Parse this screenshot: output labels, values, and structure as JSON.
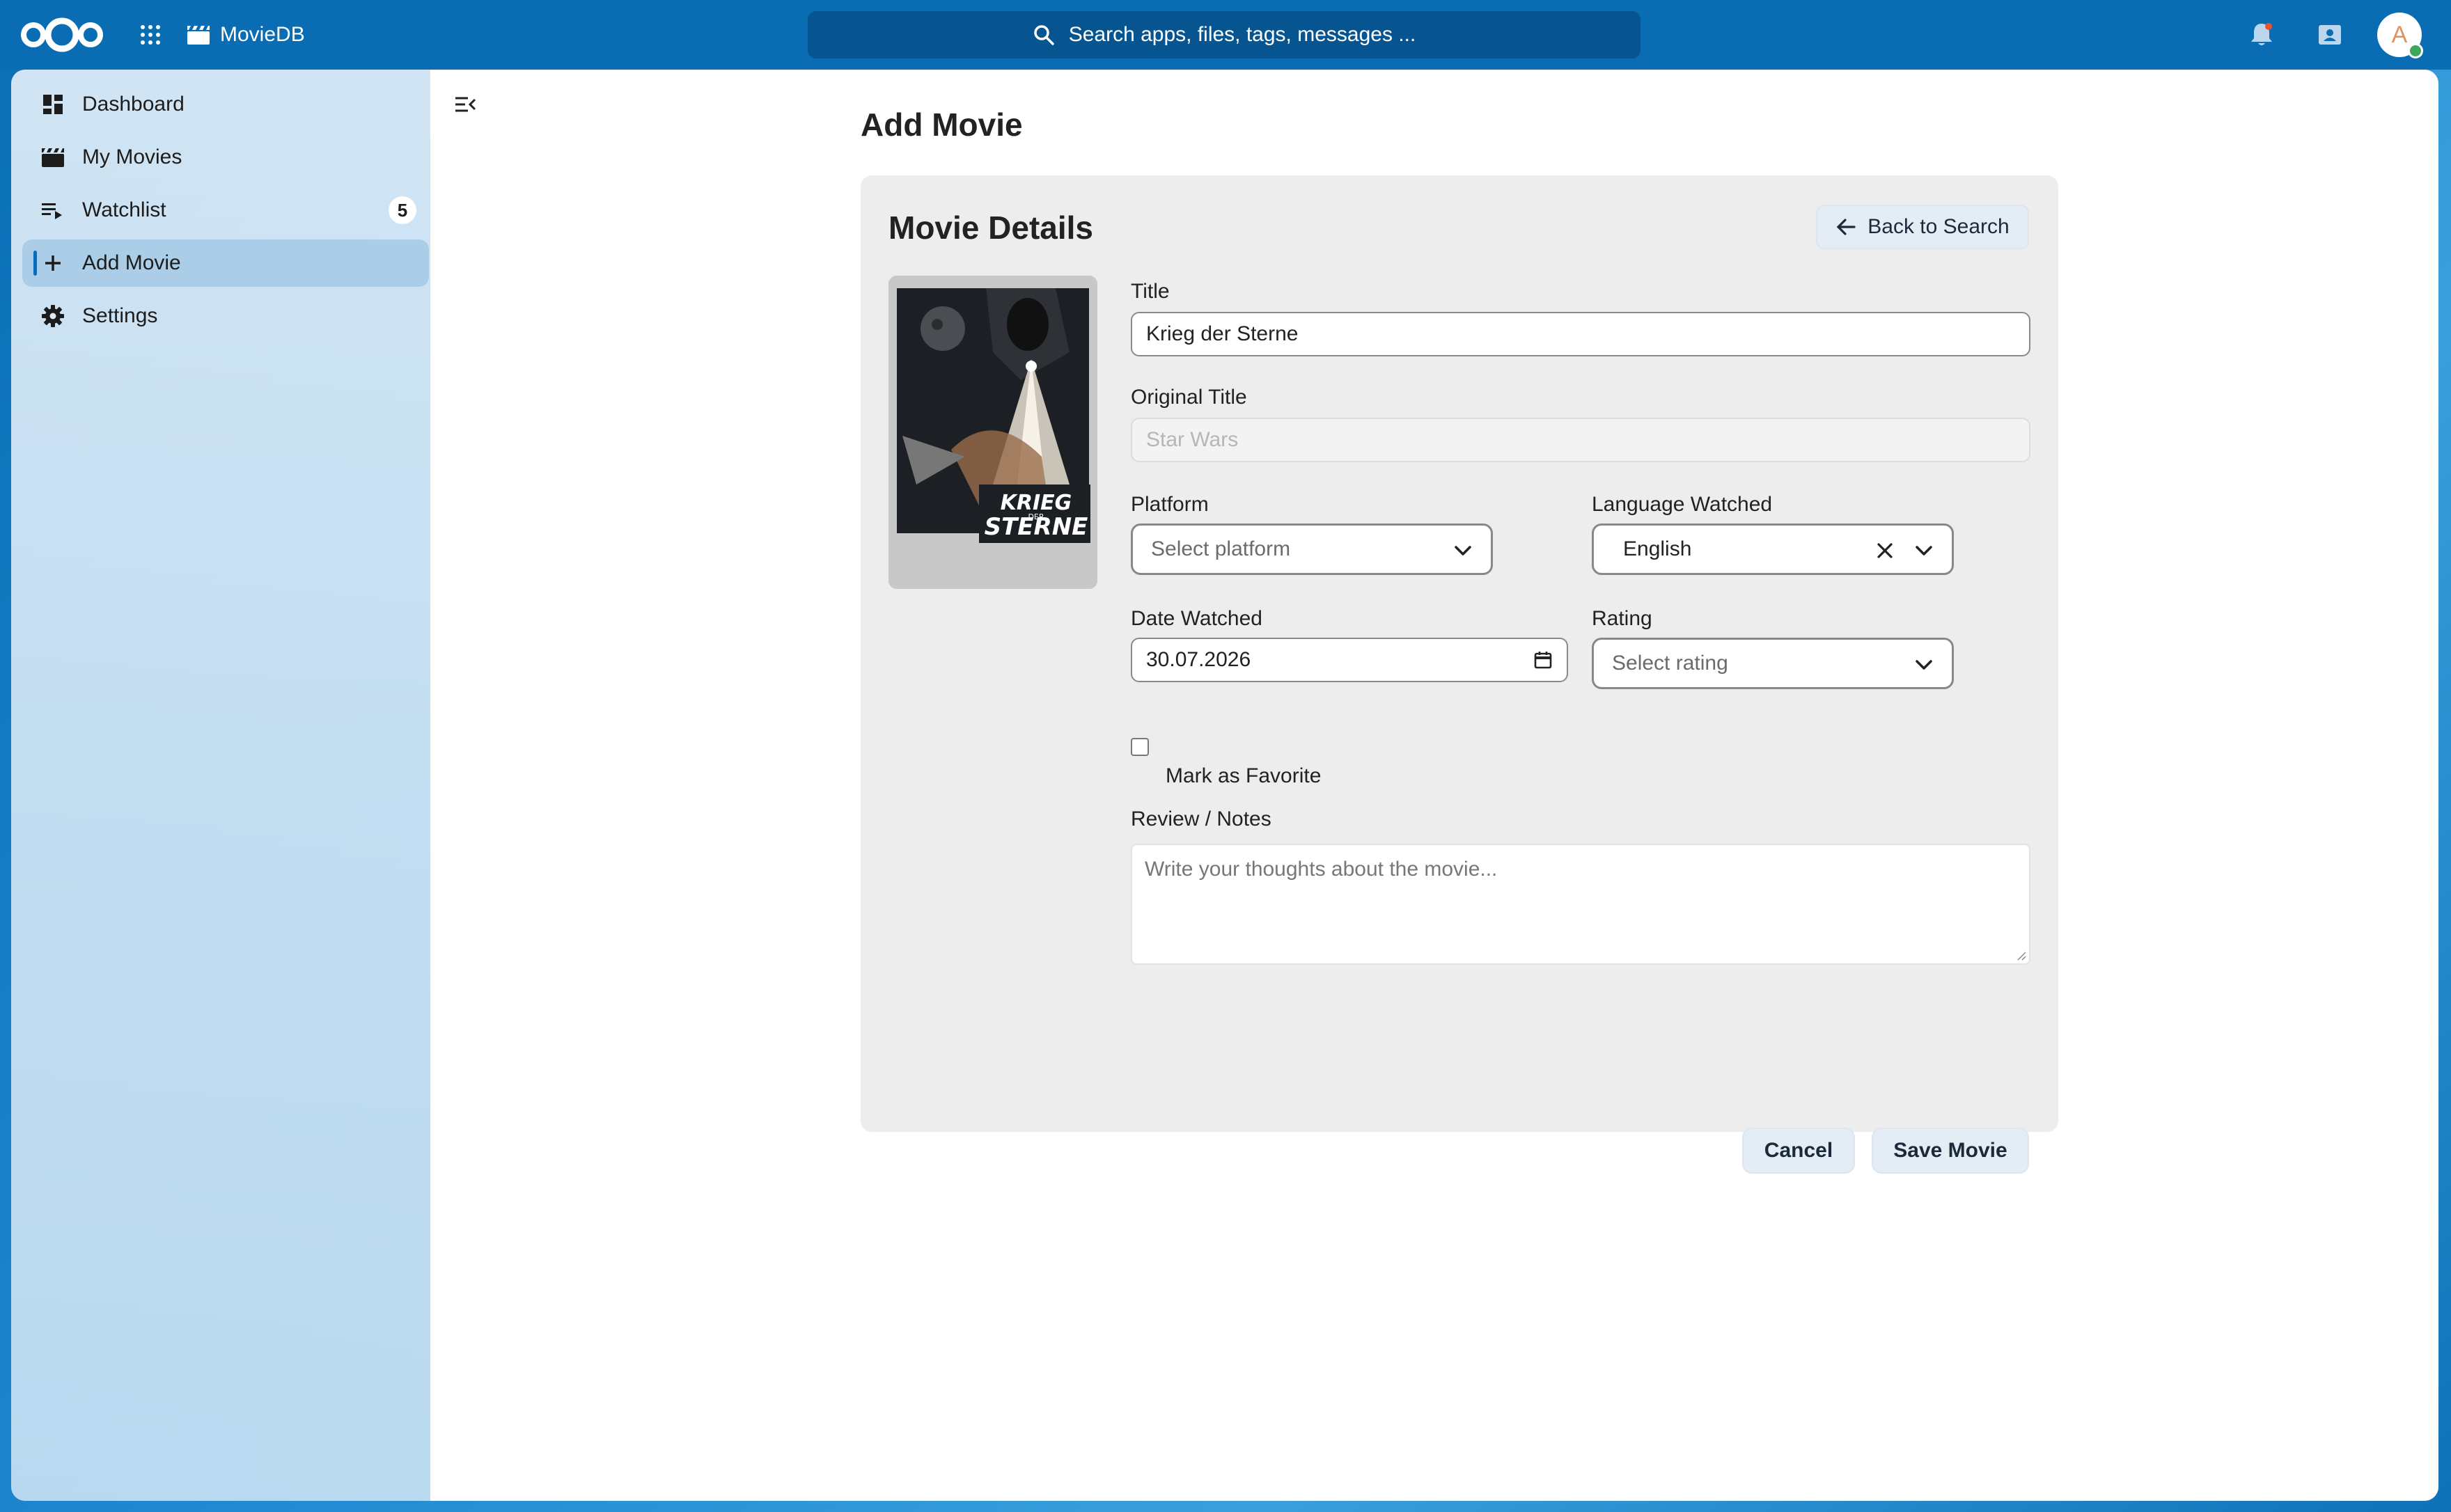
{
  "header": {
    "app_name": "MovieDB",
    "search_placeholder": "Search apps, files, tags, messages ...",
    "avatar_initial": "A"
  },
  "sidebar": {
    "items": [
      {
        "label": "Dashboard",
        "icon": "dashboard-icon"
      },
      {
        "label": "My Movies",
        "icon": "clapperboard-icon"
      },
      {
        "label": "Watchlist",
        "icon": "playlist-icon",
        "badge": "5"
      },
      {
        "label": "Add Movie",
        "icon": "plus-icon",
        "active": true
      },
      {
        "label": "Settings",
        "icon": "gear-icon"
      }
    ]
  },
  "main": {
    "page_title": "Add Movie",
    "card": {
      "title": "Movie Details",
      "back_button": "Back to Search",
      "fields": {
        "title_label": "Title",
        "title_value": "Krieg der Sterne",
        "original_title_label": "Original Title",
        "original_title_value": "Star Wars",
        "platform_label": "Platform",
        "platform_placeholder": "Select platform",
        "language_label": "Language Watched",
        "language_value": "English",
        "date_label": "Date Watched",
        "date_value": "30.07.2026",
        "rating_label": "Rating",
        "rating_placeholder": "Select rating",
        "favorite_label": "Mark as Favorite",
        "favorite_checked": false,
        "review_label": "Review / Notes",
        "review_placeholder": "Write your thoughts about the movie..."
      },
      "poster_text": "KRIEG DER STERNE",
      "actions": {
        "cancel": "Cancel",
        "save": "Save Movie"
      }
    }
  },
  "colors": {
    "header_bg": "#0a6db3",
    "card_bg": "#ededed",
    "button_bg": "#e4edf5"
  }
}
